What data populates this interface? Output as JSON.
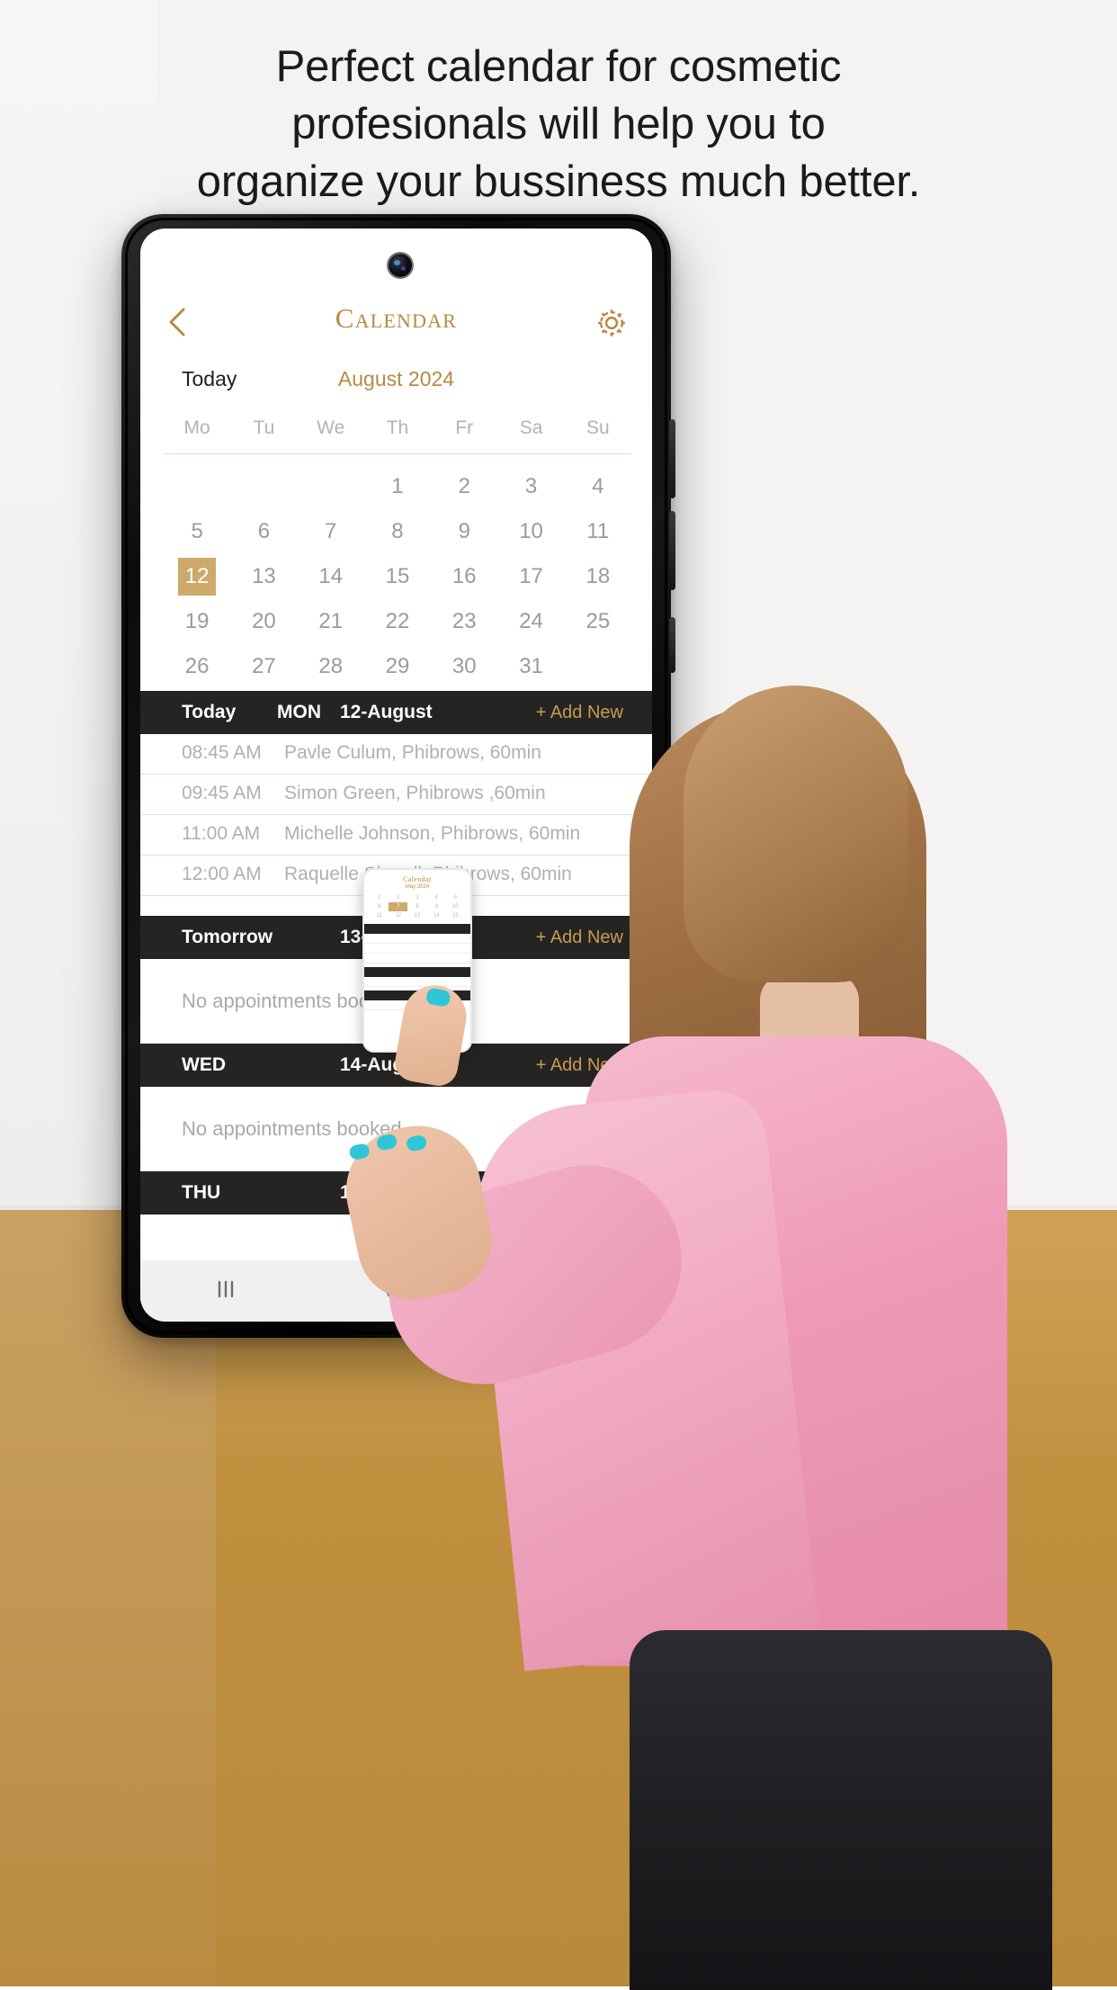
{
  "headline": {
    "line1": "Perfect calendar for cosmetic",
    "line2": "profesionals will help you to",
    "line3": "organize your bussiness much better."
  },
  "colors": {
    "gold": "#b78a42",
    "gold_accent": "#cda96a",
    "dark_bar": "#262422",
    "muted_text": "#b0b0b0",
    "background_bottom": "#c0903f"
  },
  "app": {
    "header": {
      "back_icon": "chevron-left-icon",
      "title": "Calendar",
      "settings_icon": "gear-icon"
    },
    "month_row": {
      "today_label": "Today",
      "month_label": "August 2024"
    },
    "calendar": {
      "weekdays": [
        "Mo",
        "Tu",
        "We",
        "Th",
        "Fr",
        "Sa",
        "Su"
      ],
      "selected_day": 12,
      "weeks": [
        [
          "",
          "",
          "",
          "1",
          "2",
          "3",
          "4"
        ],
        [
          "5",
          "6",
          "7",
          "8",
          "9",
          "10",
          "11"
        ],
        [
          "12",
          "13",
          "14",
          "15",
          "16",
          "17",
          "18"
        ],
        [
          "19",
          "20",
          "21",
          "22",
          "23",
          "24",
          "25"
        ],
        [
          "26",
          "27",
          "28",
          "29",
          "30",
          "31",
          ""
        ]
      ]
    },
    "agenda": {
      "add_new_label": "+ Add New",
      "empty_label": "No appointments booked",
      "sections": [
        {
          "col_a": "Today",
          "col_b": "MON",
          "col_c": "12-August",
          "has_add": true,
          "appointments": [
            {
              "time": "08:45 AM",
              "description": "Pavle Culum, Phibrows, 60min"
            },
            {
              "time": "09:45 AM",
              "description": "Simon Green, Phibrows ,60min"
            },
            {
              "time": "11:00 AM",
              "description": "Michelle Johnson, Phibrows, 60min"
            },
            {
              "time": "12:00 AM",
              "description": "Raquelle Shmell, Phibrows, 60min"
            }
          ]
        },
        {
          "col_a": "Tomorrow",
          "col_b": "",
          "col_c": "13-August",
          "has_add": true,
          "appointments": []
        },
        {
          "col_a": "WED",
          "col_b": "",
          "col_c": "14-August",
          "has_add": true,
          "appointments": []
        },
        {
          "col_a": "THU",
          "col_b": "",
          "col_c": "15-August",
          "has_add": false,
          "appointments": []
        }
      ]
    },
    "navbar": {
      "recents_icon": "recents-icon",
      "home_icon": "home-icon",
      "back_icon": "back-icon"
    }
  },
  "mini_phone": {
    "title": "Calendar",
    "subtitle": "May 2024"
  }
}
